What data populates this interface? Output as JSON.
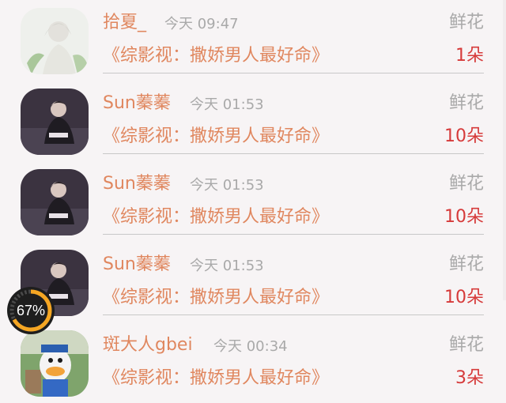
{
  "rows": [
    {
      "name": "拾夏_",
      "time": "今天 09:47",
      "gift": "鲜花",
      "book": "《综影视：撒娇男人最好命》",
      "count": "1朵",
      "avatar": "girl-sketch-avatar"
    },
    {
      "name": "Sun蓁蓁",
      "time": "今天 01:53",
      "gift": "鲜花",
      "book": "《综影视：撒娇男人最好命》",
      "count": "10朵",
      "avatar": "person-on-sofa-avatar"
    },
    {
      "name": "Sun蓁蓁",
      "time": "今天 01:53",
      "gift": "鲜花",
      "book": "《综影视：撒娇男人最好命》",
      "count": "10朵",
      "avatar": "person-on-sofa-avatar"
    },
    {
      "name": "Sun蓁蓁",
      "time": "今天 01:53",
      "gift": "鲜花",
      "book": "《综影视：撒娇男人最好命》",
      "count": "10朵",
      "avatar": "person-on-sofa-avatar"
    },
    {
      "name": "斑大人gbei",
      "time": "今天 00:34",
      "gift": "鲜花",
      "book": "《综影视：撒娇男人最好命》",
      "count": "3朵",
      "avatar": "donald-duck-avatar"
    }
  ],
  "progress": {
    "percent": 67,
    "label": "67%"
  },
  "colors": {
    "accent": "#e0875f",
    "count": "#d63a3a",
    "muted": "#a9a9a9",
    "progress": "#f5a623"
  }
}
